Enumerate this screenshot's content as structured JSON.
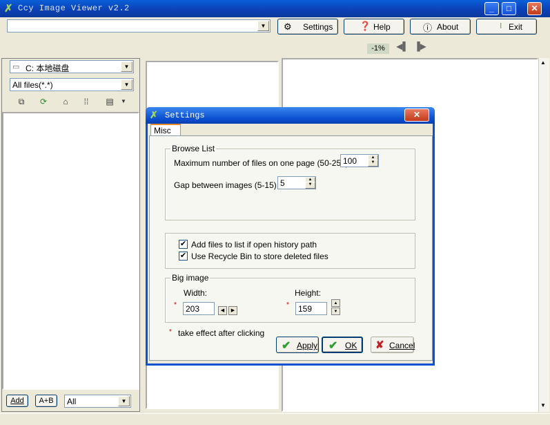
{
  "app": {
    "title": "Ccy Image Viewer v2.2"
  },
  "toolbar": {
    "path_value": "",
    "settings_label": "Settings",
    "help_label": "Help",
    "about_label": "About",
    "exit_label": "Exit",
    "zoom_label": "-1%"
  },
  "left": {
    "drive": "C: 本地磁盘",
    "filter": "All files(*.*)",
    "add_label": "Add",
    "addb_label": "A+B",
    "list_filter": "All"
  },
  "dialog": {
    "title": "Settings",
    "tab": "Misc",
    "browse": {
      "legend": "Browse List",
      "max_files_label": "Maximum number of files on one page (50-250) :",
      "max_files_value": "100",
      "gap_label": "Gap between images (5-15) :",
      "gap_value": "5"
    },
    "options": {
      "history_label": "Add files to list if open history path",
      "history_checked": true,
      "recycle_label": "Use Recycle Bin to store deleted files",
      "recycle_checked": true
    },
    "big_image": {
      "legend": "Big image",
      "width_label": "Width:",
      "width_value": "203",
      "height_label": "Height:",
      "height_value": "159"
    },
    "note_star": "*",
    "note": "take effect after clicking",
    "apply_label": "Apply",
    "ok_label": "OK",
    "cancel_label": "Cancel"
  },
  "colors": {
    "titlebar": "#0c4fc8",
    "face": "#ece9d8",
    "ok_green": "#2e9e2e",
    "cancel_red": "#c02020",
    "zoom_bg": "#cfd8c4"
  }
}
